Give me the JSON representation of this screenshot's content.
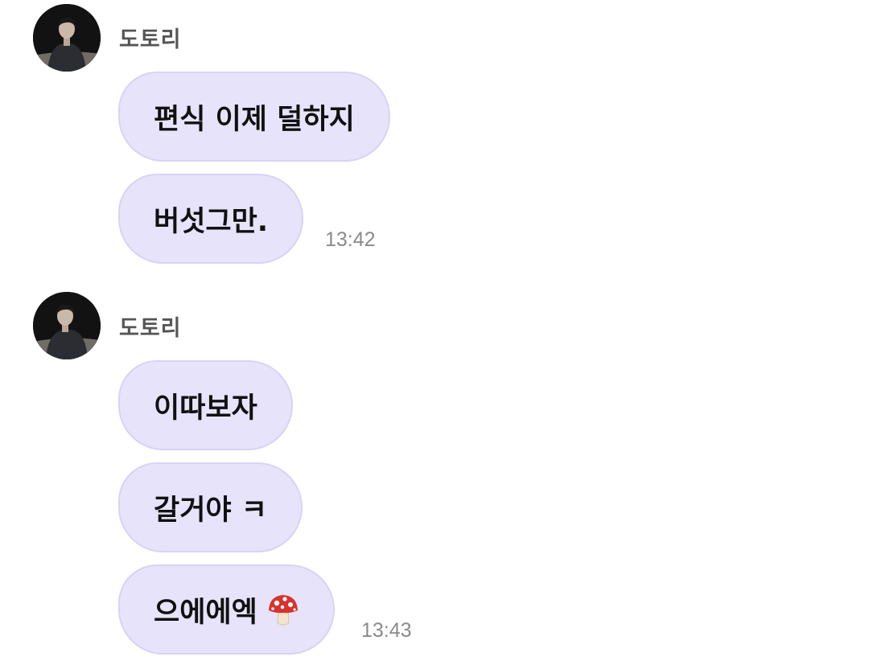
{
  "groups": [
    {
      "sender": "도토리",
      "messages": [
        {
          "text": "편식 이제 덜하지"
        },
        {
          "text": "버섯그만."
        }
      ],
      "time": "13:42"
    },
    {
      "sender": "도토리",
      "messages": [
        {
          "text": "이따보자"
        },
        {
          "text": "갈거야 ㅋ"
        },
        {
          "text": "으에에엑",
          "emoji": "mushroom-icon"
        }
      ],
      "time": "13:43"
    }
  ],
  "colors": {
    "bubble_bg": "#e7e3fb",
    "bubble_border": "#d8d3f5",
    "sender_text": "#555555",
    "time_text": "#8a8a8a",
    "message_text": "#111111"
  }
}
